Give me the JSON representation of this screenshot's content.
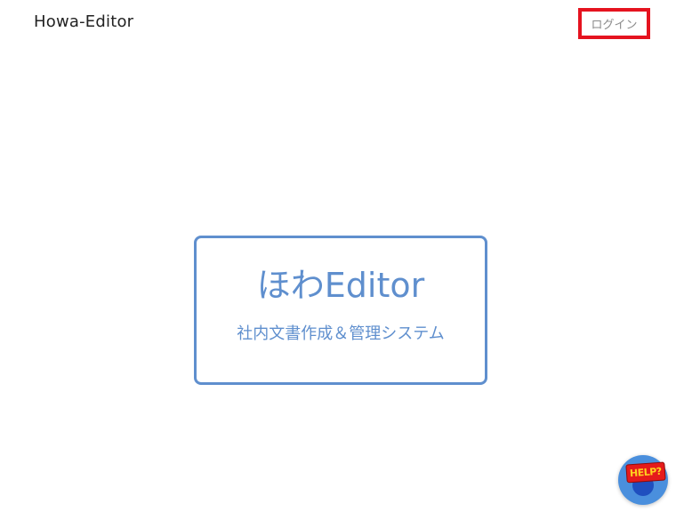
{
  "header": {
    "brand": "Howa-Editor",
    "login_label": "ログイン"
  },
  "hero": {
    "title": "ほわEditor",
    "subtitle": "社内文書作成＆管理システム"
  },
  "help": {
    "label": "HELP?"
  },
  "colors": {
    "accent": "#5f8fce",
    "login_highlight": "#e5131f",
    "help_button": "#4a8fdd"
  }
}
